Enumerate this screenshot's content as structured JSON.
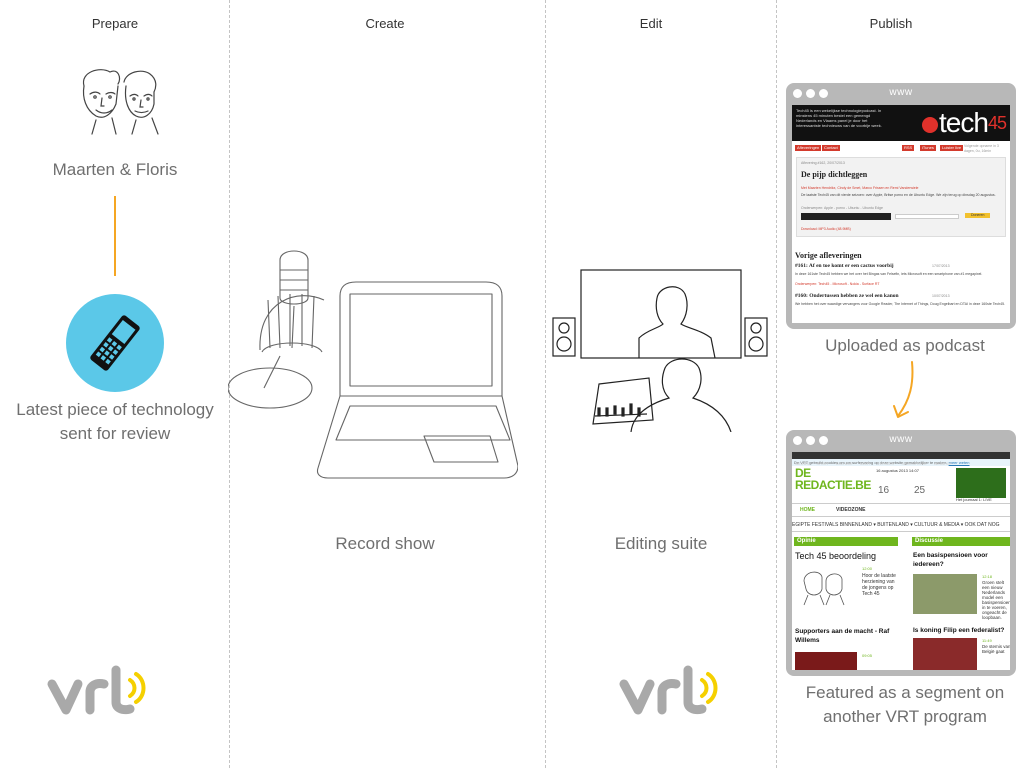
{
  "columns": [
    {
      "title": "Prepare"
    },
    {
      "title": "Create"
    },
    {
      "title": "Edit"
    },
    {
      "title": "Publish"
    }
  ],
  "prepare": {
    "hosts_caption": "Maarten & Floris",
    "device_caption_line1": "Latest piece of technology",
    "device_caption_line2": "sent for review",
    "logo_text": "vrt"
  },
  "create": {
    "caption": "Record show"
  },
  "edit": {
    "caption": "Editing suite",
    "logo_text": "vrt"
  },
  "publish": {
    "browser1": {
      "url": "www",
      "blurb": "Tech45 is een wekelijkse technologiepodcast. In minstens 45 minuten bestel een gemengd Nederlands en Vlaams panel je door het interessantste technieuws van de voorbije week.",
      "logo_prefix": "tech",
      "logo_number": "45",
      "nav_buttons": [
        "Afleveringen",
        "Contact"
      ],
      "nav_right": [
        "RSS",
        "iTunes",
        "Luister live"
      ],
      "next_recording": "Volgende opname in 3 dagen, 0u, 16min",
      "episode_meta": "Aflevering #162, 20/07/2013",
      "episode_title": "De pijp dichtleggen",
      "episode_guests": "Met Maarten Hendrikx, Cindy de Smet, Marco Frissen en Remi Vanderwiele",
      "episode_desc": "De laatste Tech45 van dit vierde seizoen: over Apple, Britse porno en de Ubuntu Edge. We zijn terug op dinsdag 20 augustus.",
      "episode_topics": "Onderwerpen: Apple - porno - Ubuntu - Ubuntu Edge",
      "donate": "Doneren",
      "download": "Download: MP3 Audio (48.9MB)",
      "previous_heading": "Vorige afleveringen",
      "prev1_title": "#161: Af en toe komt er een cactus voorbij",
      "prev1_date": "17/07/2013",
      "prev1_desc": "In deze 161ste Tech45 hebben we het over het Bingas van Felsefin, iets Microsoft en een smartphone van #1 megapixel.",
      "prev1_topics": "Onderwerpen: Tech45 - Microsoft - Nokia - Surface RT",
      "prev2_title": "#160: Ondertussen hebben ze wel een kanon",
      "prev2_date": "10/07/2013",
      "prev2_desc": "We hebben het over waardige vervangers voor Google Reader, The Internet of Things, Doug Engelbart en DTAI in deze 160ste Tech45."
    },
    "caption1": "Uploaded as podcast",
    "browser2": {
      "url": "www",
      "top_nav": [
        "NIEUWS",
        "SPORT",
        "CULTUUR",
        "MEER",
        "VERKEER",
        "RADIOSPELER",
        "WEBSHOP"
      ],
      "cookie_notice": "De VRT gebruikt cookies om uw surfervaring op deze website gemakkelijker te maken.",
      "cookie_link": "meer weten",
      "logo_line1": "DE",
      "logo_line2": "REDACTIE.BE",
      "date": "16 augustus 2013 14:07",
      "temp1": "16",
      "temp2": "25",
      "live_label": "Het journaal 1: LIVE",
      "tabs": [
        "HOME",
        "VIDEOZONE"
      ],
      "menu": "EGIPTE   FESTIVALS   BINNENLAND ▾   BUITENLAND ▾   CULTUUR & MEDIA ▾   OOK DAT NOG",
      "section_left": "Opinie",
      "section_right": "Discussie",
      "opinion_headline": "Tech 45 beoordeling",
      "opinion_time": "12:00",
      "opinion_teaser": "Hoor de laatste herziening van de jongens op Tech 45",
      "discussion_headline": "Een basispensioen voor iedereen?",
      "discussion_time": "12:18",
      "discussion_teaser": "Groen stelt een nieuw Nederlands model een basispensioen in te voeren, ongeacht de loopbaan.",
      "left_headline2": "Supporters aan de macht - Raf Willems",
      "left_time2": "09:05",
      "right_headline2": "Is koning Filip een federalist?",
      "right_time2": "11:49",
      "right_teaser2": "De stemis van België gaat"
    },
    "caption2_line1": "Featured as a segment on",
    "caption2_line2": "another VRT program"
  },
  "colors": {
    "caption_gray": "#6f6f6f",
    "accent_orange": "#f5a623",
    "phone_circle": "#5bc8e8",
    "vrt_gray": "#a9a9a9",
    "vrt_yellow": "#f5d000",
    "tech45_red": "#e0312b",
    "deredactie_green": "#6fb61e"
  }
}
